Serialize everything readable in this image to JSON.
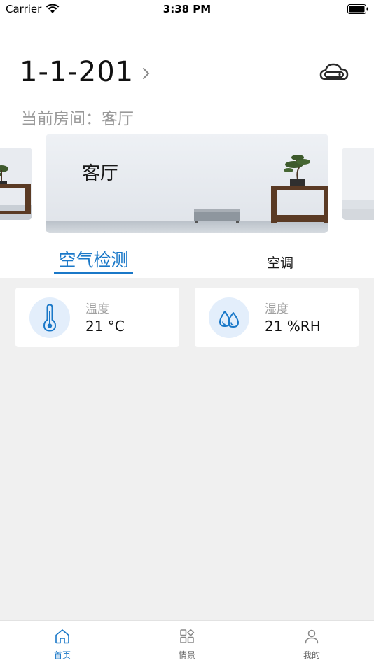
{
  "status_bar": {
    "carrier": "Carrier",
    "time": "3:38 PM"
  },
  "header": {
    "house_name": "1-1-201",
    "current_room_text": "当前房间：客厅"
  },
  "rooms": {
    "active_room_name": "客厅"
  },
  "tabs": [
    {
      "label": "空气检测",
      "active": true
    },
    {
      "label": "空调",
      "active": false
    }
  ],
  "sensors": [
    {
      "label": "温度",
      "value": "21 °C",
      "icon": "thermometer-icon"
    },
    {
      "label": "湿度",
      "value": "21 %RH",
      "icon": "water-drop-icon"
    }
  ],
  "bottom_nav": [
    {
      "label": "首页",
      "icon": "home-icon",
      "active": true
    },
    {
      "label": "情景",
      "icon": "scene-grid-icon",
      "active": false
    },
    {
      "label": "我的",
      "icon": "user-icon",
      "active": false
    }
  ],
  "colors": {
    "accent": "#1a78c8",
    "background": "#f0f0f0",
    "icon_bg": "#e3eefb"
  }
}
